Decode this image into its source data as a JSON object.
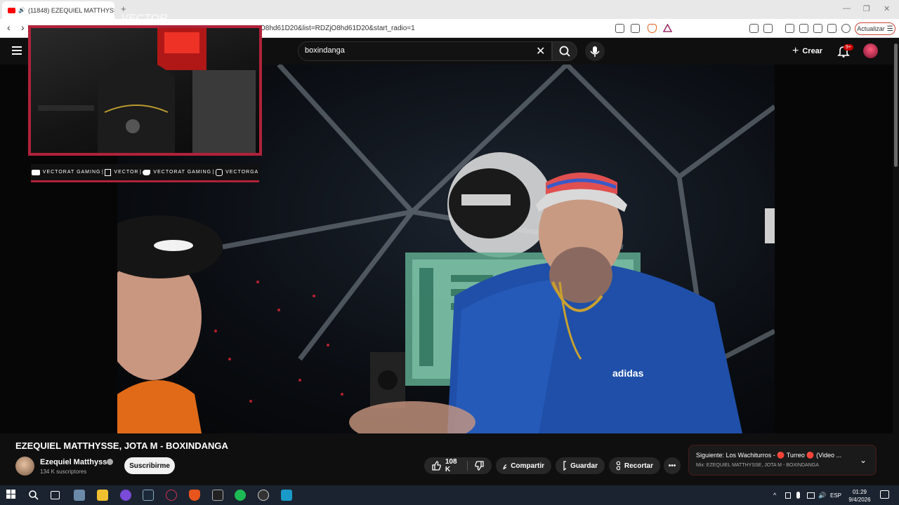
{
  "browser": {
    "tab_title": "(11848) EZEQUIEL MATTHYSS",
    "tab_close": "×",
    "new_tab": "+",
    "url_visible": "O8hd61D20&list=RDZjO8hd61D20&start_radio=1",
    "update_label": "Actualizar",
    "win_minimize": "—",
    "win_restore": "❐",
    "win_close": "✕"
  },
  "youtube": {
    "search_query": "boxindanga",
    "create_label": "Crear",
    "notifications_badge": "9+"
  },
  "overlay": {
    "watermark": "VECTOR",
    "socials": [
      "VECTORAT GAMING",
      "VECTOR",
      "VECTORAT GAMING",
      "VECTORGA"
    ]
  },
  "video": {
    "title": "EZEQUIEL MATTHYSSE, JOTA M - BOXINDANGA",
    "channel_name": "Ezequiel Matthysse",
    "subscribers": "134 K suscriptores",
    "subscribe_label": "Suscribirme",
    "likes": "108 K",
    "share_label": "Compartir",
    "save_label": "Guardar",
    "clip_label": "Recortar",
    "more_label": "•••"
  },
  "next_up": {
    "title": "Siguiente: Los Wachiturros - 🔴 Turreo 🔴 (Video ...",
    "subtitle": "Mix: EZEQUIEL MATTHYSSE, JOTA M - BOXINDANGA"
  },
  "taskbar": {
    "language": "ESP",
    "time": "01:29",
    "date": "9/4/2026"
  },
  "colors": {
    "accent_red": "#b0223a",
    "yt_red": "#ff0000",
    "dark_bg": "#0f0f0f",
    "taskbar_bg": "#1b2330"
  }
}
